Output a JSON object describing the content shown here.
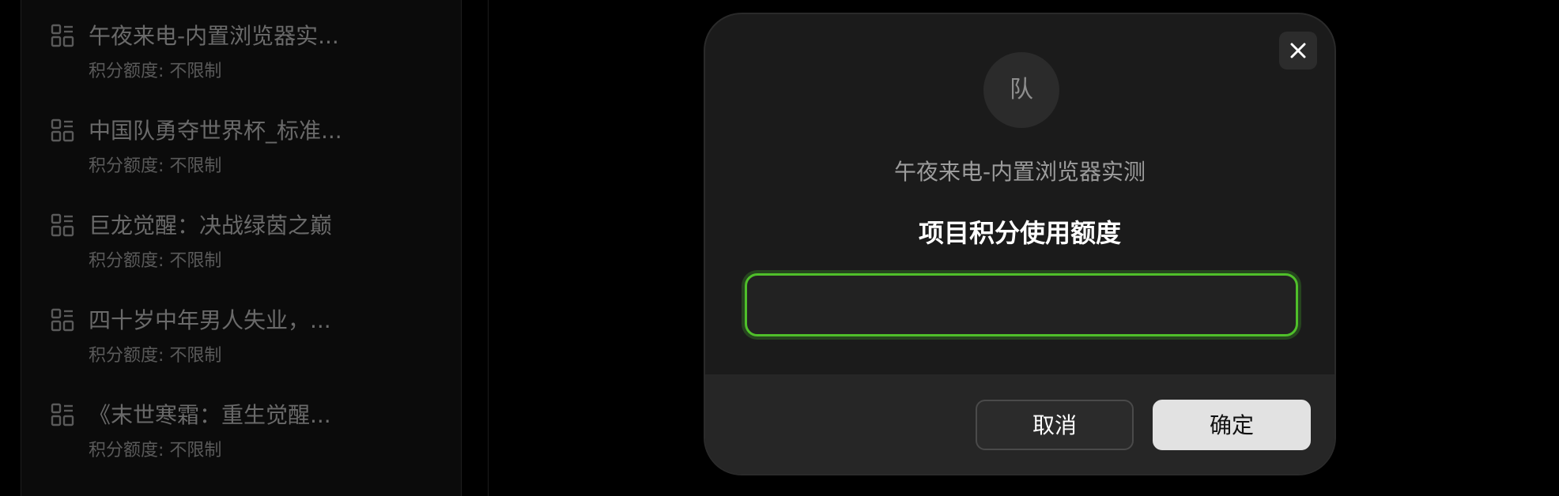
{
  "project_list": {
    "items": [
      {
        "title": "午夜来电-内置浏览器实...",
        "quota": "积分额度: 不限制",
        "icon": "grid-icon"
      },
      {
        "title": "中国队勇夺世界杯_标准...",
        "quota": "积分额度: 不限制",
        "icon": "grid-icon"
      },
      {
        "title": "巨龙觉醒：决战绿茵之巅",
        "quota": "积分额度: 不限制",
        "icon": "grid-icon"
      },
      {
        "title": "四十岁中年男人失业，...",
        "quota": "积分额度: 不限制",
        "icon": "grid-icon"
      },
      {
        "title": "《末世寒霜：重生觉醒...",
        "quota": "积分额度: 不限制",
        "icon": "grid-icon"
      }
    ]
  },
  "modal": {
    "close_icon": "close-icon",
    "avatar_text": "队",
    "project_name": "午夜来电-内置浏览器实测",
    "title": "项目积分使用额度",
    "input_value": "",
    "cancel_label": "取消",
    "confirm_label": "确定"
  },
  "colors": {
    "input_focus_border": "#4fbf2a",
    "modal_bg": "#1b1b1b",
    "confirm_bg": "#e2e2e2"
  }
}
